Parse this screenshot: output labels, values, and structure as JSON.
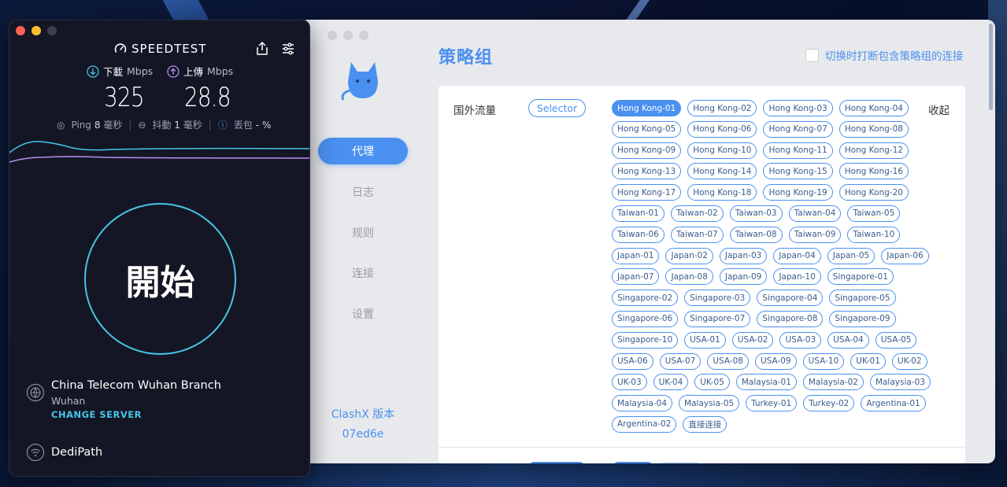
{
  "clashx": {
    "nav": [
      {
        "label": "代理",
        "active": true
      },
      {
        "label": "日志",
        "active": false
      },
      {
        "label": "规则",
        "active": false
      },
      {
        "label": "连接",
        "active": false
      },
      {
        "label": "设置",
        "active": false
      }
    ],
    "version_label": "ClashX 版本",
    "version_hash": "07ed6e",
    "page_title": "策略组",
    "switch_label": "切换时打断包含策略组的连接",
    "group": {
      "name": "国外流量",
      "type": "Selector",
      "collapse_label": "收起",
      "selected": "Hong Kong-01",
      "proxies": [
        "Hong Kong-01",
        "Hong Kong-02",
        "Hong Kong-03",
        "Hong Kong-04",
        "Hong Kong-05",
        "Hong Kong-06",
        "Hong Kong-07",
        "Hong Kong-08",
        "Hong Kong-09",
        "Hong Kong-10",
        "Hong Kong-11",
        "Hong Kong-12",
        "Hong Kong-13",
        "Hong Kong-14",
        "Hong Kong-15",
        "Hong Kong-16",
        "Hong Kong-17",
        "Hong Kong-18",
        "Hong Kong-19",
        "Hong Kong-20",
        "Taiwan-01",
        "Taiwan-02",
        "Taiwan-03",
        "Taiwan-04",
        "Taiwan-05",
        "Taiwan-06",
        "Taiwan-07",
        "Taiwan-08",
        "Taiwan-09",
        "Taiwan-10",
        "Japan-01",
        "Japan-02",
        "Japan-03",
        "Japan-04",
        "Japan-05",
        "Japan-06",
        "Japan-07",
        "Japan-08",
        "Japan-09",
        "Japan-10",
        "Singapore-01",
        "Singapore-02",
        "Singapore-03",
        "Singapore-04",
        "Singapore-05",
        "Singapore-06",
        "Singapore-07",
        "Singapore-08",
        "Singapore-09",
        "Singapore-10",
        "USA-01",
        "USA-02",
        "USA-03",
        "USA-04",
        "USA-05",
        "USA-06",
        "USA-07",
        "USA-08",
        "USA-09",
        "USA-10",
        "UK-01",
        "UK-02",
        "UK-03",
        "UK-04",
        "UK-05",
        "Malaysia-01",
        "Malaysia-02",
        "Malaysia-03",
        "Malaysia-04",
        "Malaysia-05",
        "Turkey-01",
        "Turkey-02",
        "Argentina-01",
        "Argentina-02",
        "直接连接"
      ]
    },
    "accent": "#4a90f0"
  },
  "speedtest": {
    "brand": "SPEEDTEST",
    "download": {
      "label": "下載",
      "unit": "Mbps",
      "value": "325"
    },
    "upload": {
      "label": "上傳",
      "unit": "Mbps",
      "value": "28.8"
    },
    "ping": {
      "label": "Ping",
      "value": "8",
      "unit": "毫秒"
    },
    "jitter": {
      "label": "抖動",
      "value": "1",
      "unit": "毫秒"
    },
    "loss": {
      "label": "丟包",
      "value": "- %"
    },
    "go_label": "開始",
    "server": {
      "name": "China Telecom Wuhan Branch",
      "city": "Wuhan",
      "change_label": "CHANGE SERVER"
    },
    "isp": "DediPath",
    "accent": "#46c6e6"
  }
}
